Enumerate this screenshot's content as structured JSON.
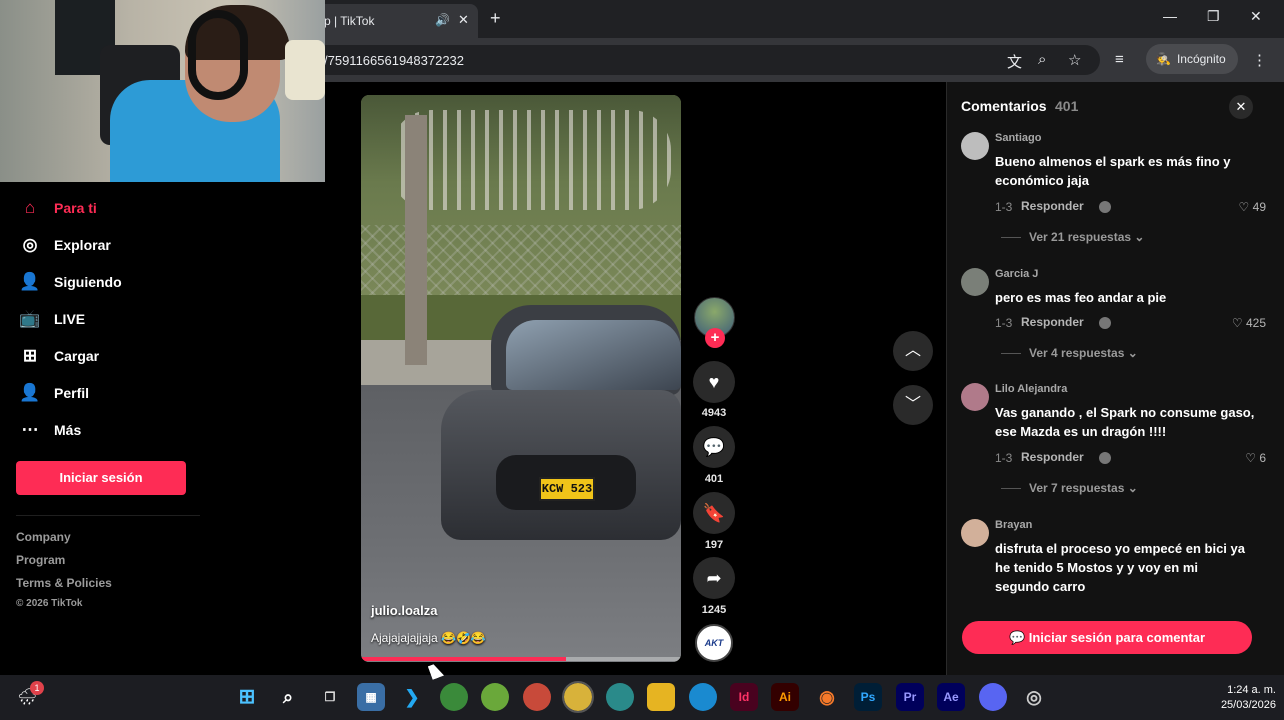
{
  "browser": {
    "tab_title": "p | TikTok",
    "url": "/7591166561948372232",
    "incognito_label": "Incógnito"
  },
  "sidebar": {
    "items": [
      {
        "label": "Para ti",
        "icon": "home-icon",
        "active": true
      },
      {
        "label": "Explorar",
        "icon": "compass-icon"
      },
      {
        "label": "Siguiendo",
        "icon": "following-icon"
      },
      {
        "label": "LIVE",
        "icon": "live-icon"
      },
      {
        "label": "Cargar",
        "icon": "upload-icon"
      },
      {
        "label": "Perfil",
        "icon": "profile-icon"
      },
      {
        "label": "Más",
        "icon": "more-icon"
      }
    ],
    "login_button": "Iniciar sesión",
    "footer": [
      "Company",
      "Program",
      "Terms & Policies",
      "© 2026 TikTok"
    ]
  },
  "video": {
    "username": "julio.loalza",
    "caption": "Ajajajajajjaja 😂🤣😂",
    "plate": "KCW 523",
    "progress": 0.64
  },
  "actions": {
    "likes": "4943",
    "comments": "401",
    "saves": "197",
    "shares": "1245",
    "music_label": "AKT"
  },
  "comments_panel": {
    "title": "Comentarios",
    "count": "401",
    "items": [
      {
        "author": "Santiago",
        "text": "Bueno almenos el spark es más fino y económico jaja",
        "date": "1-3",
        "reply": "Responder",
        "likes": "49",
        "more": "Ver 21 respuestas ⌄"
      },
      {
        "author": "Garcia J",
        "text": "pero es mas feo andar a pie",
        "date": "1-3",
        "reply": "Responder",
        "likes": "425",
        "more": "Ver 4 respuestas ⌄"
      },
      {
        "author": "Lilo Alejandra",
        "text": "Vas ganando , el Spark no consume gaso, ese Mazda es un dragón !!!!",
        "date": "1-3",
        "reply": "Responder",
        "likes": "6",
        "more": "Ver 7 respuestas ⌄"
      },
      {
        "author": "Brayan",
        "text": "disfruta el proceso yo empecé en bici ya he tenido 5 Mostos y y voy en mi segundo carro"
      }
    ],
    "login_button": "Iniciar sesión para comentar"
  },
  "taskbar": {
    "notification_badge": "1",
    "time": "1:24 a. m.",
    "date": "25/03/2026"
  },
  "colors": {
    "accent": "#fe2c55",
    "background": "#000000"
  }
}
